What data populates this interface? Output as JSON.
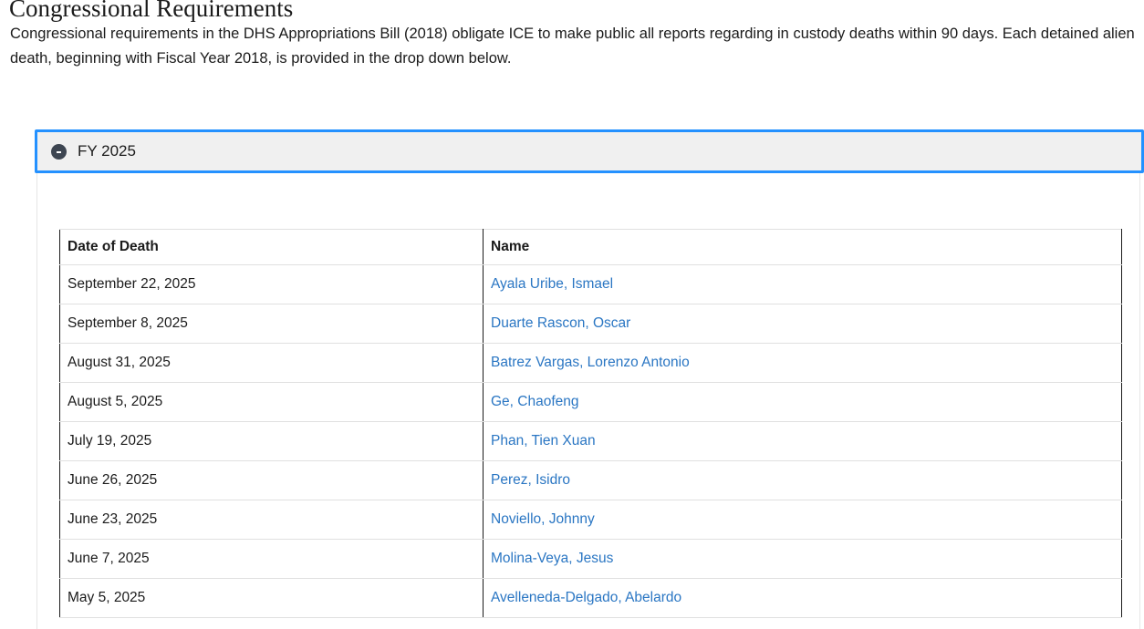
{
  "page": {
    "title": "Congressional Requirements",
    "intro": "Congressional requirements in the DHS Appropriations Bill (2018) obligate ICE to make public all reports regarding in custody deaths within 90 days. Each detained alien death, beginning with Fiscal Year 2018, is provided in the drop down below."
  },
  "accordion": {
    "label": "FY 2025",
    "expanded": true,
    "icon": "minus-circle-icon",
    "focus_color": "#2491ff"
  },
  "table": {
    "headers": [
      "Date of Death",
      "Name"
    ],
    "rows": [
      {
        "date": "September 22, 2025",
        "name": "Ayala Uribe, Ismael"
      },
      {
        "date": "September 8, 2025",
        "name": "Duarte Rascon, Oscar"
      },
      {
        "date": "August 31, 2025",
        "name": "Batrez Vargas, Lorenzo Antonio"
      },
      {
        "date": "August 5, 2025",
        "name": "Ge, Chaofeng"
      },
      {
        "date": "July 19, 2025",
        "name": "Phan, Tien Xuan"
      },
      {
        "date": "June 26, 2025",
        "name": "Perez, Isidro"
      },
      {
        "date": "June 23, 2025",
        "name": "Noviello, Johnny"
      },
      {
        "date": "June 7, 2025",
        "name": "Molina-Veya, Jesus"
      },
      {
        "date": "May 5, 2025",
        "name": "Avelleneda-Delgado, Abelardo"
      }
    ]
  },
  "colors": {
    "link": "#2a76c3",
    "text": "#1b1b1b",
    "accordion_bg": "#f0f0f0"
  }
}
